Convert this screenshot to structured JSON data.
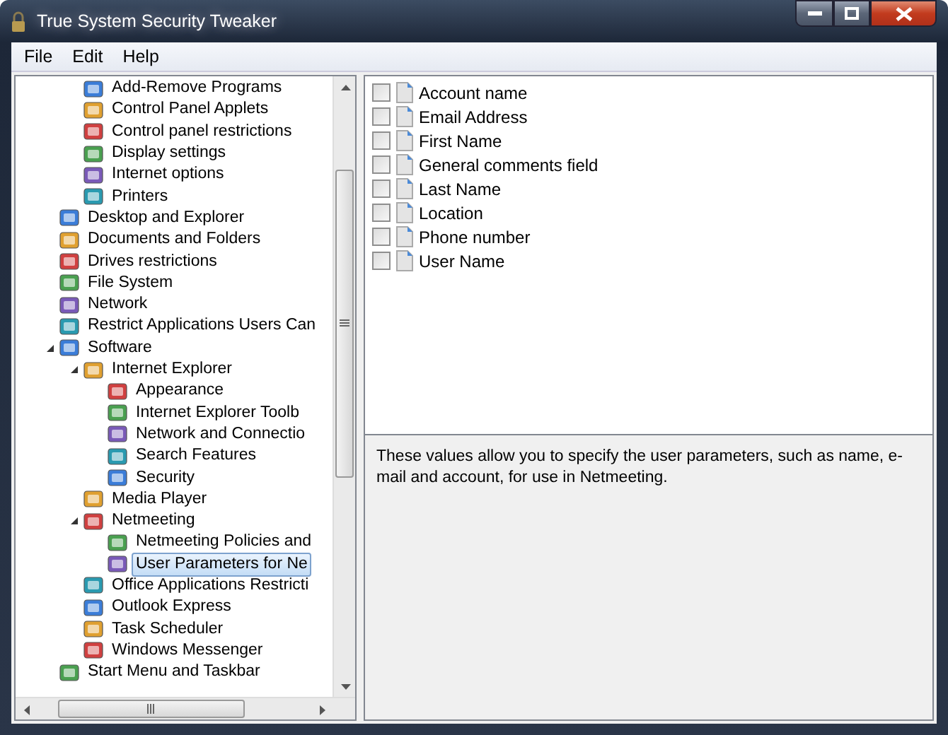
{
  "window": {
    "title": "True System Security Tweaker"
  },
  "menu": [
    "File",
    "Edit",
    "Help"
  ],
  "tree": {
    "items_continued_from_above": [
      {
        "label": "Add-Remove Programs",
        "selected": false
      },
      {
        "label": "Control Panel Applets",
        "selected": false
      },
      {
        "label": "Control panel restrictions",
        "selected": false
      },
      {
        "label": "Display settings",
        "selected": false
      },
      {
        "label": "Internet options",
        "selected": false
      },
      {
        "label": "Printers",
        "selected": false
      }
    ],
    "items": [
      {
        "label": "Desktop and Explorer",
        "selected": false
      },
      {
        "label": "Documents and Folders",
        "selected": false
      },
      {
        "label": "Drives restrictions",
        "selected": false
      },
      {
        "label": "File System",
        "selected": false
      },
      {
        "label": "Network",
        "selected": false
      },
      {
        "label": "Restrict Applications Users Can",
        "selected": false
      },
      {
        "label": "Software",
        "selected": false,
        "expanded": true,
        "children": [
          {
            "label": "Internet Explorer",
            "selected": false,
            "expanded": true,
            "children": [
              {
                "label": "Appearance",
                "selected": false
              },
              {
                "label": "Internet Explorer Toolb",
                "selected": false
              },
              {
                "label": "Network and Connectio",
                "selected": false
              },
              {
                "label": "Search Features",
                "selected": false
              },
              {
                "label": "Security",
                "selected": false
              }
            ]
          },
          {
            "label": "Media Player",
            "selected": false
          },
          {
            "label": "Netmeeting",
            "selected": false,
            "expanded": true,
            "children": [
              {
                "label": "Netmeeting Policies and",
                "selected": false
              },
              {
                "label": "User Parameters for Ne",
                "selected": true
              }
            ]
          },
          {
            "label": "Office Applications Restricti",
            "selected": false
          },
          {
            "label": "Outlook Express",
            "selected": false
          },
          {
            "label": "Task Scheduler",
            "selected": false
          },
          {
            "label": "Windows Messenger",
            "selected": false
          }
        ]
      },
      {
        "label": "Start Menu and Taskbar",
        "selected": false
      }
    ]
  },
  "settings": [
    {
      "label": "Account name",
      "checked": false
    },
    {
      "label": "Email Address",
      "checked": false
    },
    {
      "label": "First Name",
      "checked": false
    },
    {
      "label": "General comments field",
      "checked": false
    },
    {
      "label": "Last Name",
      "checked": false
    },
    {
      "label": "Location",
      "checked": false
    },
    {
      "label": "Phone number",
      "checked": false
    },
    {
      "label": "User Name",
      "checked": false
    }
  ],
  "description": "These values allow you to specify the user parameters, such as name, e-mail and account, for use in Netmeeting."
}
